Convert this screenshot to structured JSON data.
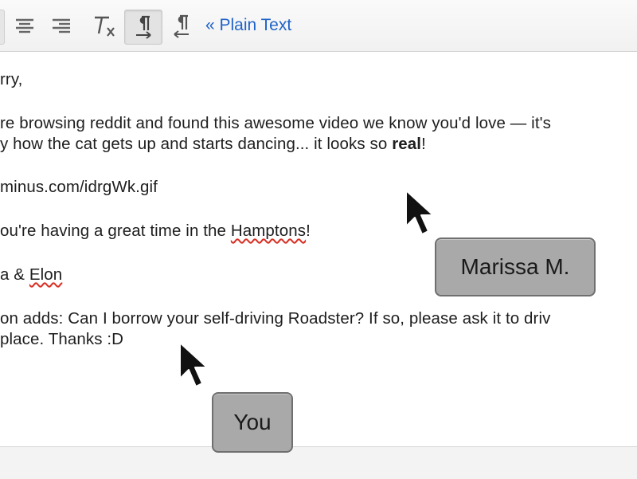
{
  "toolbar": {
    "plain_text_link": "« Plain Text",
    "icons": [
      "align-center-icon",
      "align-right-icon",
      "remove-formatting-icon",
      "ltr-text-icon",
      "rtl-text-icon"
    ]
  },
  "email": {
    "greeting": "rry,",
    "para1_line1": "re browsing reddit and found this awesome video we know you'd love — it's",
    "para1_line2_pre": "y how the cat gets up and starts dancing... it looks so ",
    "para1_line2_bold": "real",
    "para1_line2_post": "!",
    "link": "minus.com/idrgWk.gif",
    "wish_pre": "ou're having a great time in the ",
    "wish_place": "Hamptons",
    "wish_post": "!",
    "sign_pre": "a & ",
    "sign_name": "Elon",
    "ps_line1_pre": "on adds: Can I borrow your self-driving ",
    "ps_line1_word": "Roadster",
    "ps_line1_post": "?  If so, please ask it to driv",
    "ps_line2": "place.  Thanks :D"
  },
  "collaborators": {
    "other_label": "Marissa M.",
    "self_label": "You"
  },
  "colors": {
    "link": "#1f63c8",
    "spell_underline": "#d93025",
    "badge_bg": "#a9a9a9"
  }
}
